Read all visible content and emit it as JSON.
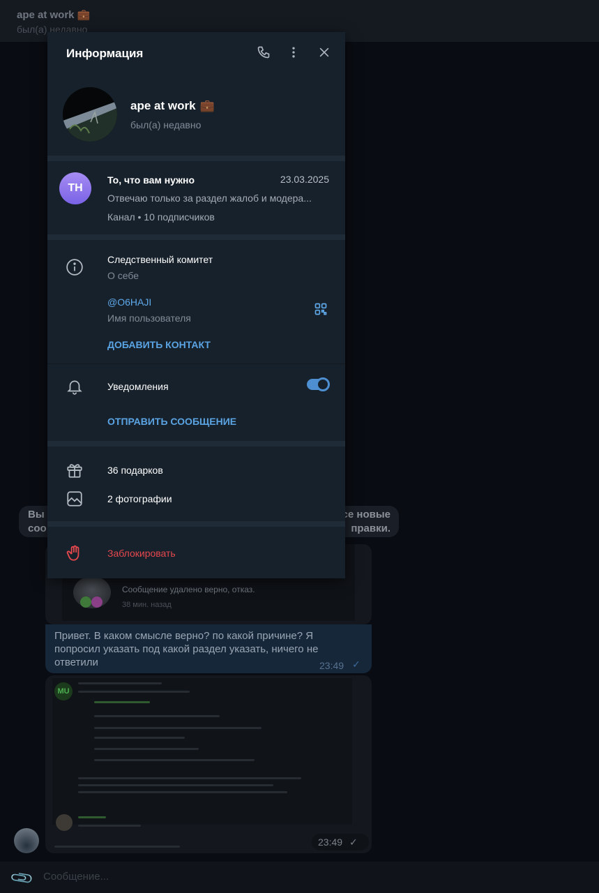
{
  "background": {
    "header_title": "ape at work",
    "header_status": "был(а) недавно",
    "system_message_left": "Вы в\nсоо",
    "system_message_right": "се новые\nправки.",
    "card_text": "Сообщение удалено верно, отказ.",
    "card_time": "38 мин. назад",
    "outgoing_text": "Привет. В каком смысле верно? по какой причине? Я попросил указать под какой раздел указать, ничего не ответили",
    "outgoing_time": "23:49",
    "screenshot_avatar_label": "MU",
    "screenshot_time": "23:49",
    "composer_placeholder": "Сообщение..."
  },
  "panel": {
    "title": "Информация",
    "profile": {
      "name": "ape at work",
      "status": "был(а) недавно"
    },
    "channel": {
      "initials": "TH",
      "name": "То, что вам нужно",
      "date": "23.03.2025",
      "preview": "Отвечаю только за раздел жалоб и модера...",
      "meta": "Канал • 10 подписчиков"
    },
    "about": {
      "value": "Следственный комитет",
      "label": "О себе"
    },
    "username": {
      "value": "@O6HAJI",
      "label": "Имя пользователя"
    },
    "add_contact": "ДОБАВИТЬ КОНТАКТ",
    "notifications": {
      "label": "Уведомления",
      "enabled": true
    },
    "send_message": "ОТПРАВИТЬ СООБЩЕНИЕ",
    "gifts": "36 подарков",
    "photos": "2 фотографии",
    "block": "Заблокировать"
  },
  "colors": {
    "accent": "#5aa4e4",
    "danger": "#e5484d",
    "panel_bg": "#17212b",
    "channel_avatar": "#8f77ef"
  },
  "icons": [
    "phone-icon",
    "more-vertical-icon",
    "close-icon",
    "briefcase-icon",
    "info-icon",
    "qr-code-icon",
    "bell-icon",
    "gift-icon",
    "photo-icon",
    "hand-block-icon",
    "paperclip-icon",
    "check-icon"
  ]
}
